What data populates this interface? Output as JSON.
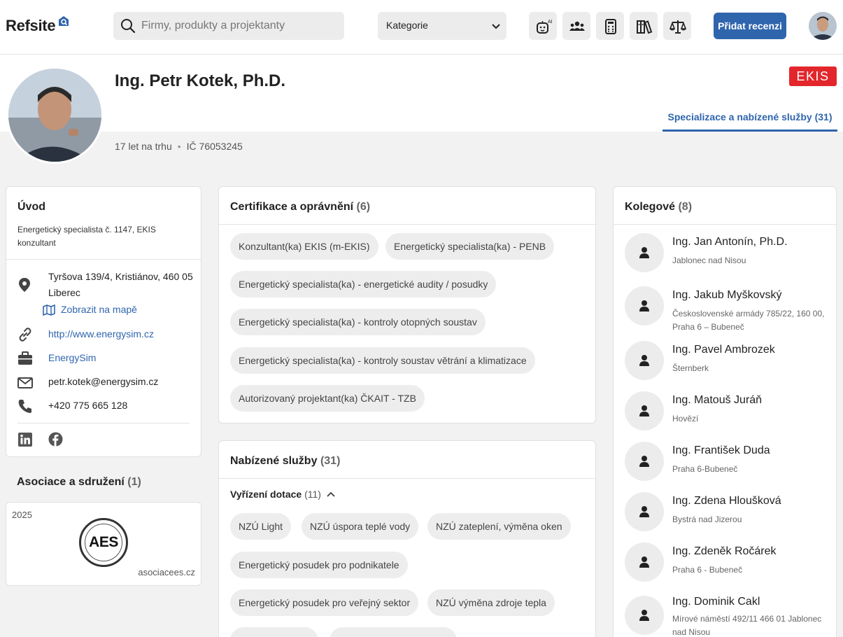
{
  "topbar": {
    "logo_text": "Refsite",
    "search_placeholder": "Firmy, produkty a projektanty",
    "category_label": "Kategorie",
    "ai_badge": "AI",
    "add_review_label": "Přidat recenzi",
    "icons": [
      "ai-assistant-icon",
      "people-icon",
      "calculator-icon",
      "books-icon",
      "scales-icon"
    ]
  },
  "profile": {
    "name": "Ing. Petr Kotek, Ph.D.",
    "years": "17 let na trhu",
    "ic": "IČ 76053245",
    "brand_logo": "EKIS",
    "tab_label": "Specializace a nabízené služby (31)"
  },
  "intro": {
    "title": "Úvod",
    "description": "Energetický specialista č. 1147, EKIS konzultant",
    "address": "Tyršova 139/4, Kristiánov, 460 05 Liberec",
    "map_link": "Zobrazit na mapě",
    "website": "http://www.energysim.cz",
    "company": "EnergySim",
    "email": "petr.kotek@energysim.cz",
    "phone": "+420 775 665 128"
  },
  "associations": {
    "title": "Asociace a sdružení",
    "count": "(1)",
    "year": "2025",
    "logo_text": "AES",
    "domain": "asociacees.cz"
  },
  "certifications": {
    "title": "Certifikace a oprávnění",
    "count": "(6)",
    "items": [
      "Konzultant(ka) EKIS (m-EKIS)",
      "Energetický specialista(ka) - PENB",
      "Energetický specialista(ka) - energetické audity / posudky",
      "Energetický specialista(ka) - kontroly otopných soustav",
      "Energetický specialista(ka) - kontroly soustav větrání a klimatizace",
      "Autorizovaný projektant(ka) ČKAIT - TZB"
    ]
  },
  "services": {
    "title": "Nabízené služby",
    "count": "(31)",
    "group_title": "Vyřízení dotace",
    "group_count": "(11)",
    "items": [
      "NZÚ Light",
      "NZÚ úspora teplé vody",
      "NZÚ zateplení, výměna oken",
      "Energetický posudek pro podnikatele",
      "Energetický posudek pro veřejný sektor",
      "NZÚ výměna zdroje tepla"
    ]
  },
  "colleagues": {
    "title": "Kolegové",
    "count": "(8)",
    "items": [
      {
        "name": "Ing. Jan Antonín, Ph.D.",
        "location": "Jablonec nad Nisou"
      },
      {
        "name": "Ing. Jakub Myškovský",
        "location": "Československé armády 785/22, 160 00, Praha 6 – Bubeneč"
      },
      {
        "name": "Ing. Pavel Ambrozek",
        "location": "Šternberk"
      },
      {
        "name": "Ing. Matouš Juráň",
        "location": "Hovězí"
      },
      {
        "name": "Ing. František Duda",
        "location": "Praha 6-Bubeneč"
      },
      {
        "name": "Ing. Zdena Hloušková",
        "location": "Bystrá nad Jizerou"
      },
      {
        "name": "Ing. Zdeněk Ročárek",
        "location": "Praha 6 - Bubeneč"
      },
      {
        "name": "Ing. Dominik Cakl",
        "location": "Mírové náměstí 492/11 466 01 Jablonec nad Nisou"
      }
    ]
  },
  "colors": {
    "accent": "#2f65ad",
    "brand_red": "#e3262b",
    "chip_bg": "#ededed"
  }
}
